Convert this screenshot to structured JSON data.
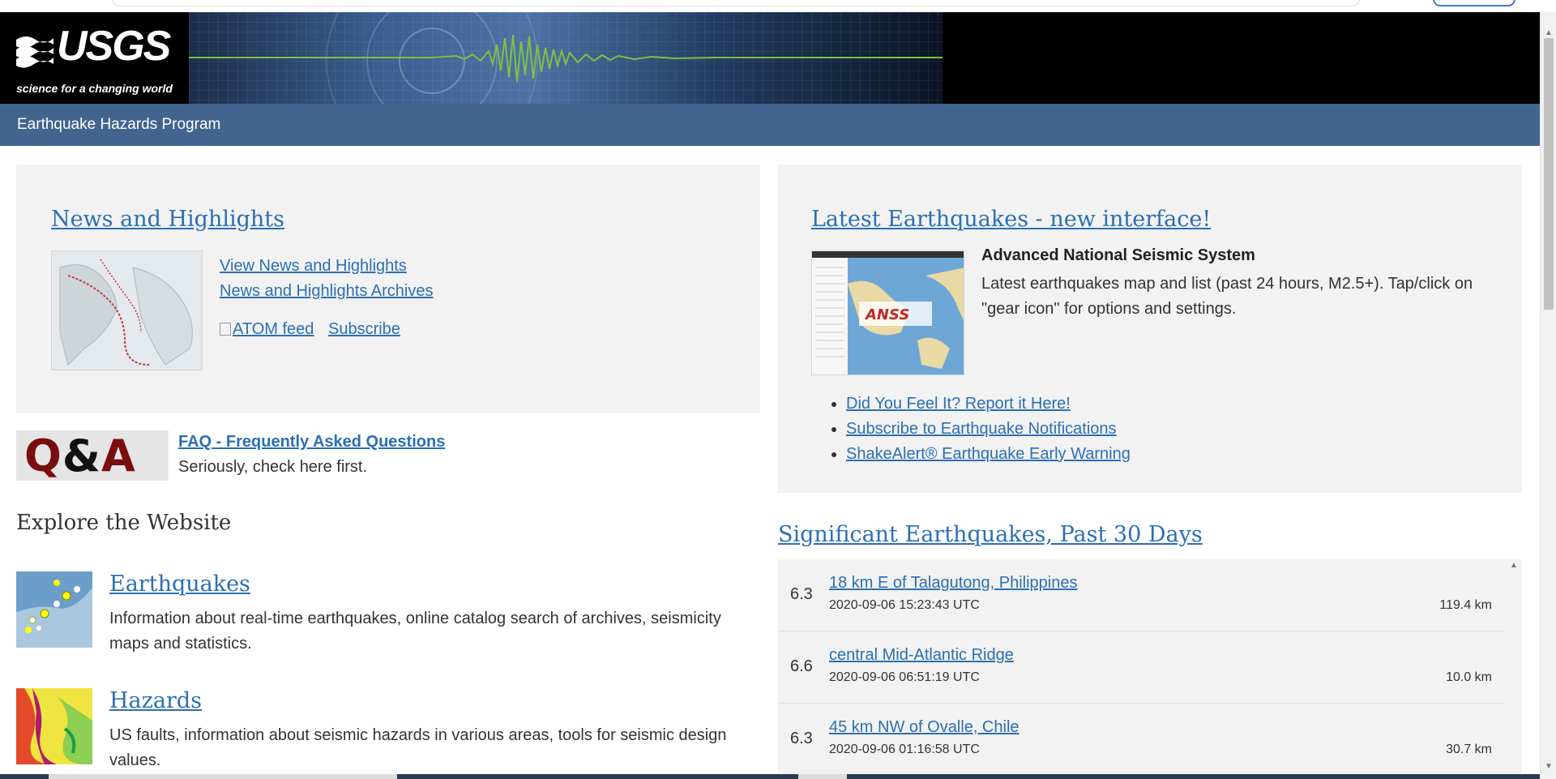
{
  "header": {
    "logo_text": "USGS",
    "tagline": "science for a changing world",
    "program_name": "Earthquake Hazards Program"
  },
  "news": {
    "title": "News and Highlights",
    "links": [
      "View News and Highlights",
      "News and Highlights Archives"
    ],
    "atom_feed": "ATOM feed",
    "subscribe": "Subscribe"
  },
  "faq": {
    "image_text_q": "Q",
    "image_text_amp": "&",
    "image_text_a": "A",
    "link": "FAQ - Frequently Asked Questions",
    "subtitle": "Seriously, check here first."
  },
  "explore": {
    "title": "Explore the Website",
    "items": [
      {
        "title": "Earthquakes",
        "description": "Information about real-time earthquakes, online catalog search of archives, seismicity maps and statistics."
      },
      {
        "title": "Hazards",
        "description": "US faults, information about seismic hazards in various areas, tools for seismic design values."
      }
    ]
  },
  "latest": {
    "title": "Latest Earthquakes - new interface!",
    "image_label": "ANSS",
    "anss_title": "Advanced National Seismic System",
    "anss_desc": "Latest earthquakes map and list (past 24 hours, M2.5+). Tap/click on \"gear icon\" for options and settings.",
    "links": [
      "Did You Feel It? Report it Here!",
      "Subscribe to Earthquake Notifications",
      "ShakeAlert® Earthquake Early Warning"
    ]
  },
  "significant": {
    "title": "Significant Earthquakes, Past 30 Days",
    "rows": [
      {
        "mag": "6.3",
        "place": "18 km E of Talagutong, Philippines",
        "time": "2020-09-06 15:23:43 UTC",
        "depth": "119.4 km"
      },
      {
        "mag": "6.6",
        "place": "central Mid-Atlantic Ridge",
        "time": "2020-09-06 06:51:19 UTC",
        "depth": "10.0 km"
      },
      {
        "mag": "6.3",
        "place": "45 km NW of Ovalle, Chile",
        "time": "2020-09-06 01:16:58 UTC",
        "depth": "30.7 km"
      }
    ]
  },
  "colors": {
    "program_bar": "#42648f",
    "link": "#2b6fb3",
    "panel": "#f2f2f2"
  }
}
